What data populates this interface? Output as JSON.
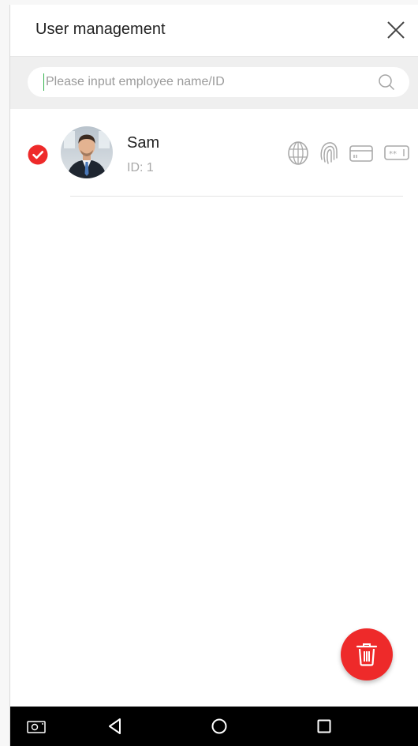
{
  "header": {
    "title": "User management"
  },
  "search": {
    "placeholder": "Please input employee name/ID",
    "value": ""
  },
  "users": [
    {
      "name": "Sam",
      "id_label": "ID: ",
      "id": "1",
      "selected": true,
      "credentials": [
        "face-icon",
        "fingerprint-icon",
        "card-icon",
        "password-icon"
      ]
    }
  ],
  "colors": {
    "accent": "#ee2a2a",
    "cursor": "#32b34c",
    "search_bg": "#efefef",
    "nav_bg": "#000000"
  },
  "nav": {
    "buttons": [
      "screenshot-icon",
      "back-icon",
      "home-icon",
      "recents-icon"
    ]
  }
}
